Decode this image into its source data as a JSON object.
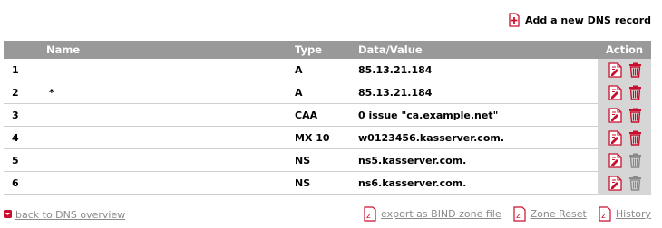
{
  "header": {
    "add_record_label": "Add a new DNS record"
  },
  "table": {
    "columns": {
      "num": "",
      "name": "Name",
      "type": "Type",
      "data": "Data/Value",
      "action": "Action"
    },
    "rows": [
      {
        "num": "1",
        "name": "",
        "type": "A",
        "data": "85.13.21.184",
        "deletable": true
      },
      {
        "num": "2",
        "name": "*",
        "type": "A",
        "data": "85.13.21.184",
        "deletable": true
      },
      {
        "num": "3",
        "name": "",
        "type": "CAA",
        "data": "0 issue \"ca.example.net\"",
        "deletable": true
      },
      {
        "num": "4",
        "name": "",
        "type": "MX 10",
        "data": "w0123456.kasserver.com.",
        "deletable": true
      },
      {
        "num": "5",
        "name": "",
        "type": "NS",
        "data": "ns5.kasserver.com.",
        "deletable": false
      },
      {
        "num": "6",
        "name": "",
        "type": "NS",
        "data": "ns6.kasserver.com.",
        "deletable": false
      }
    ]
  },
  "footer": {
    "back_label": "back to DNS overview",
    "export_label": "export as BIND zone file",
    "reset_label": "Zone Reset",
    "history_label": "History"
  },
  "icons": {
    "add": "add-document-icon",
    "edit": "edit-document-icon",
    "delete": "trash-icon",
    "back": "back-arrow-icon",
    "file": "zone-file-icon"
  },
  "colors": {
    "accent": "#c8102e",
    "disabled": "#8a8a8a",
    "header_bg": "#999999",
    "action_bg": "#d6d6d6"
  }
}
